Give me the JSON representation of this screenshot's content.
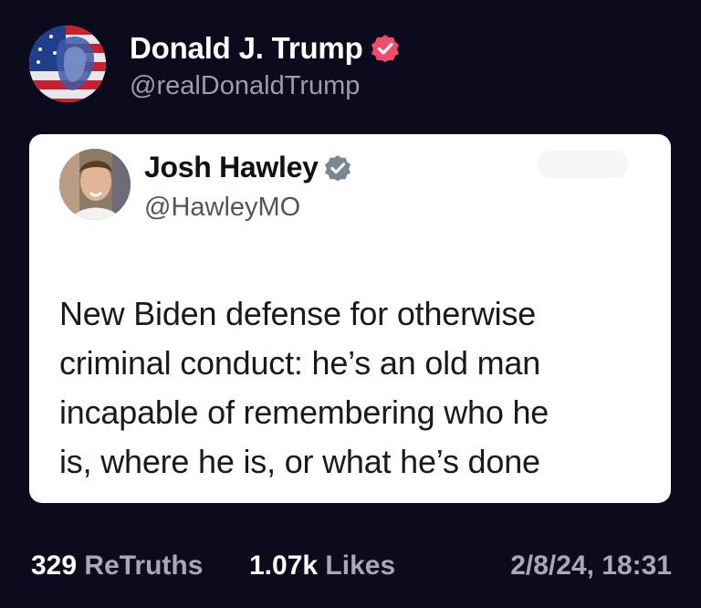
{
  "post": {
    "author_name": "Donald J. Trump",
    "author_handle": "@realDonaldTrump",
    "avatar": "flag-portrait-avatar",
    "verified_icon": "verified-badge-icon",
    "badge_color": "#f04d6a"
  },
  "quoted": {
    "author_name": "Josh Hawley",
    "author_handle": "@HawleyMO",
    "verified_icon": "verified-badge-icon",
    "badge_color": "#7b8694",
    "text_lines": [
      "New Biden defense for otherwise",
      "criminal conduct: he’s an old man",
      "incapable of remembering who he",
      "is, where he is, or what he’s done"
    ]
  },
  "stats": {
    "retruths_count": "329",
    "retruths_label": "ReTruths",
    "likes_count": "1.07k",
    "likes_label": "Likes",
    "timestamp": "2/8/24, 18:31"
  }
}
